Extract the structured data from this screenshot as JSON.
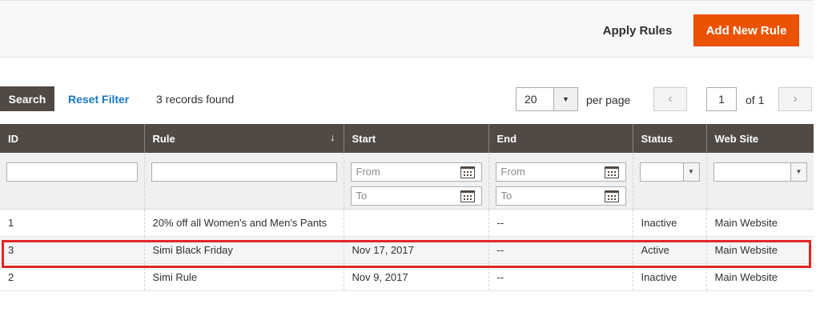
{
  "actions": {
    "apply_label": "Apply Rules",
    "add_label": "Add New Rule"
  },
  "toolbar": {
    "search_label": "Search",
    "reset_label": "Reset Filter",
    "records_text": "3 records found",
    "per_page_value": "20",
    "per_page_label": "per page",
    "page_value": "1",
    "page_of": "of 1"
  },
  "columns": [
    "ID",
    "Rule",
    "Start",
    "End",
    "Status",
    "Web Site"
  ],
  "filters": {
    "from_placeholder": "From",
    "to_placeholder": "To"
  },
  "rows": [
    {
      "id": "1",
      "rule": "20% off all Women's and Men's Pants",
      "start": "",
      "end": "--",
      "status": "Inactive",
      "website": "Main Website"
    },
    {
      "id": "3",
      "rule": "Simi Black Friday",
      "start": "Nov 17, 2017",
      "end": "--",
      "status": "Active",
      "website": "Main Website"
    },
    {
      "id": "2",
      "rule": "Simi Rule",
      "start": "Nov 9, 2017",
      "end": "--",
      "status": "Inactive",
      "website": "Main Website"
    }
  ],
  "colors": {
    "accent": "#eb5202",
    "header_bg": "#514943",
    "link": "#1979c3",
    "highlight": "#e22626"
  }
}
